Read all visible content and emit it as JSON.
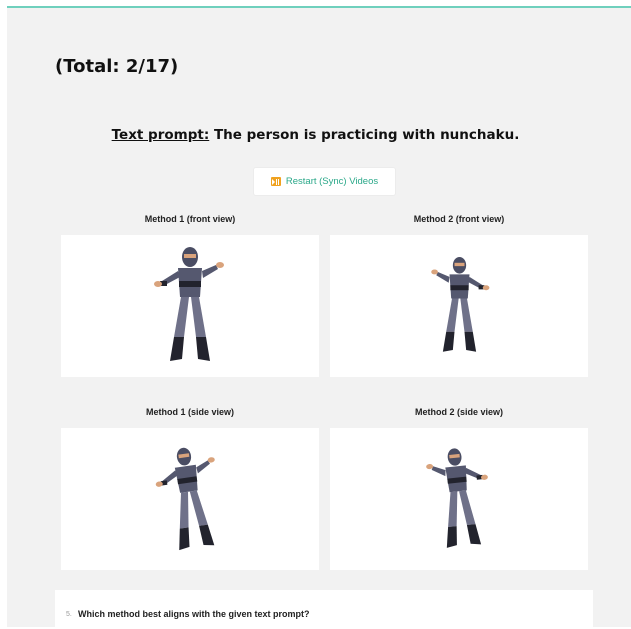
{
  "total": "(Total: 2/17)",
  "prompt": {
    "label": "Text prompt:",
    "text": "The person is practicing with nunchaku."
  },
  "restart_button": {
    "icon": "play-pause-icon",
    "label": "Restart (Sync) Videos"
  },
  "videos": [
    {
      "label": "Method 1 (front view)"
    },
    {
      "label": "Method 2 (front view)"
    },
    {
      "label": "Method 1 (side view)"
    },
    {
      "label": "Method 2 (side view)"
    }
  ],
  "question": {
    "number": "5.",
    "text": "Which method best aligns with the given text prompt?"
  },
  "colors": {
    "accent": "#2aa889",
    "top_border": "#6fd0bd",
    "panel_bg": "#f2f2f2",
    "icon_bg": "#f0a21f"
  }
}
